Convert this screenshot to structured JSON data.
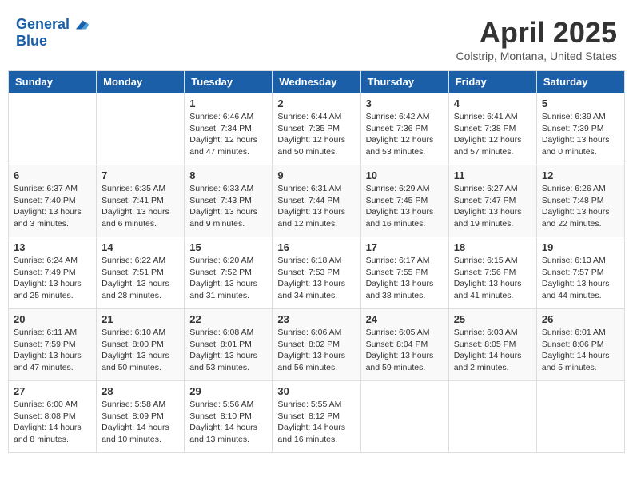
{
  "header": {
    "logo_line1": "General",
    "logo_line2": "Blue",
    "month": "April 2025",
    "location": "Colstrip, Montana, United States"
  },
  "days_of_week": [
    "Sunday",
    "Monday",
    "Tuesday",
    "Wednesday",
    "Thursday",
    "Friday",
    "Saturday"
  ],
  "weeks": [
    [
      {
        "day": "",
        "sunrise": "",
        "sunset": "",
        "daylight": ""
      },
      {
        "day": "",
        "sunrise": "",
        "sunset": "",
        "daylight": ""
      },
      {
        "day": "1",
        "sunrise": "Sunrise: 6:46 AM",
        "sunset": "Sunset: 7:34 PM",
        "daylight": "Daylight: 12 hours and 47 minutes."
      },
      {
        "day": "2",
        "sunrise": "Sunrise: 6:44 AM",
        "sunset": "Sunset: 7:35 PM",
        "daylight": "Daylight: 12 hours and 50 minutes."
      },
      {
        "day": "3",
        "sunrise": "Sunrise: 6:42 AM",
        "sunset": "Sunset: 7:36 PM",
        "daylight": "Daylight: 12 hours and 53 minutes."
      },
      {
        "day": "4",
        "sunrise": "Sunrise: 6:41 AM",
        "sunset": "Sunset: 7:38 PM",
        "daylight": "Daylight: 12 hours and 57 minutes."
      },
      {
        "day": "5",
        "sunrise": "Sunrise: 6:39 AM",
        "sunset": "Sunset: 7:39 PM",
        "daylight": "Daylight: 13 hours and 0 minutes."
      }
    ],
    [
      {
        "day": "6",
        "sunrise": "Sunrise: 6:37 AM",
        "sunset": "Sunset: 7:40 PM",
        "daylight": "Daylight: 13 hours and 3 minutes."
      },
      {
        "day": "7",
        "sunrise": "Sunrise: 6:35 AM",
        "sunset": "Sunset: 7:41 PM",
        "daylight": "Daylight: 13 hours and 6 minutes."
      },
      {
        "day": "8",
        "sunrise": "Sunrise: 6:33 AM",
        "sunset": "Sunset: 7:43 PM",
        "daylight": "Daylight: 13 hours and 9 minutes."
      },
      {
        "day": "9",
        "sunrise": "Sunrise: 6:31 AM",
        "sunset": "Sunset: 7:44 PM",
        "daylight": "Daylight: 13 hours and 12 minutes."
      },
      {
        "day": "10",
        "sunrise": "Sunrise: 6:29 AM",
        "sunset": "Sunset: 7:45 PM",
        "daylight": "Daylight: 13 hours and 16 minutes."
      },
      {
        "day": "11",
        "sunrise": "Sunrise: 6:27 AM",
        "sunset": "Sunset: 7:47 PM",
        "daylight": "Daylight: 13 hours and 19 minutes."
      },
      {
        "day": "12",
        "sunrise": "Sunrise: 6:26 AM",
        "sunset": "Sunset: 7:48 PM",
        "daylight": "Daylight: 13 hours and 22 minutes."
      }
    ],
    [
      {
        "day": "13",
        "sunrise": "Sunrise: 6:24 AM",
        "sunset": "Sunset: 7:49 PM",
        "daylight": "Daylight: 13 hours and 25 minutes."
      },
      {
        "day": "14",
        "sunrise": "Sunrise: 6:22 AM",
        "sunset": "Sunset: 7:51 PM",
        "daylight": "Daylight: 13 hours and 28 minutes."
      },
      {
        "day": "15",
        "sunrise": "Sunrise: 6:20 AM",
        "sunset": "Sunset: 7:52 PM",
        "daylight": "Daylight: 13 hours and 31 minutes."
      },
      {
        "day": "16",
        "sunrise": "Sunrise: 6:18 AM",
        "sunset": "Sunset: 7:53 PM",
        "daylight": "Daylight: 13 hours and 34 minutes."
      },
      {
        "day": "17",
        "sunrise": "Sunrise: 6:17 AM",
        "sunset": "Sunset: 7:55 PM",
        "daylight": "Daylight: 13 hours and 38 minutes."
      },
      {
        "day": "18",
        "sunrise": "Sunrise: 6:15 AM",
        "sunset": "Sunset: 7:56 PM",
        "daylight": "Daylight: 13 hours and 41 minutes."
      },
      {
        "day": "19",
        "sunrise": "Sunrise: 6:13 AM",
        "sunset": "Sunset: 7:57 PM",
        "daylight": "Daylight: 13 hours and 44 minutes."
      }
    ],
    [
      {
        "day": "20",
        "sunrise": "Sunrise: 6:11 AM",
        "sunset": "Sunset: 7:59 PM",
        "daylight": "Daylight: 13 hours and 47 minutes."
      },
      {
        "day": "21",
        "sunrise": "Sunrise: 6:10 AM",
        "sunset": "Sunset: 8:00 PM",
        "daylight": "Daylight: 13 hours and 50 minutes."
      },
      {
        "day": "22",
        "sunrise": "Sunrise: 6:08 AM",
        "sunset": "Sunset: 8:01 PM",
        "daylight": "Daylight: 13 hours and 53 minutes."
      },
      {
        "day": "23",
        "sunrise": "Sunrise: 6:06 AM",
        "sunset": "Sunset: 8:02 PM",
        "daylight": "Daylight: 13 hours and 56 minutes."
      },
      {
        "day": "24",
        "sunrise": "Sunrise: 6:05 AM",
        "sunset": "Sunset: 8:04 PM",
        "daylight": "Daylight: 13 hours and 59 minutes."
      },
      {
        "day": "25",
        "sunrise": "Sunrise: 6:03 AM",
        "sunset": "Sunset: 8:05 PM",
        "daylight": "Daylight: 14 hours and 2 minutes."
      },
      {
        "day": "26",
        "sunrise": "Sunrise: 6:01 AM",
        "sunset": "Sunset: 8:06 PM",
        "daylight": "Daylight: 14 hours and 5 minutes."
      }
    ],
    [
      {
        "day": "27",
        "sunrise": "Sunrise: 6:00 AM",
        "sunset": "Sunset: 8:08 PM",
        "daylight": "Daylight: 14 hours and 8 minutes."
      },
      {
        "day": "28",
        "sunrise": "Sunrise: 5:58 AM",
        "sunset": "Sunset: 8:09 PM",
        "daylight": "Daylight: 14 hours and 10 minutes."
      },
      {
        "day": "29",
        "sunrise": "Sunrise: 5:56 AM",
        "sunset": "Sunset: 8:10 PM",
        "daylight": "Daylight: 14 hours and 13 minutes."
      },
      {
        "day": "30",
        "sunrise": "Sunrise: 5:55 AM",
        "sunset": "Sunset: 8:12 PM",
        "daylight": "Daylight: 14 hours and 16 minutes."
      },
      {
        "day": "",
        "sunrise": "",
        "sunset": "",
        "daylight": ""
      },
      {
        "day": "",
        "sunrise": "",
        "sunset": "",
        "daylight": ""
      },
      {
        "day": "",
        "sunrise": "",
        "sunset": "",
        "daylight": ""
      }
    ]
  ]
}
